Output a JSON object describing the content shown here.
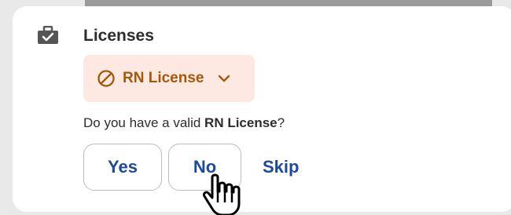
{
  "section": {
    "title": "Licenses",
    "icon": "briefcase-check-icon"
  },
  "license_chip": {
    "label": "RN License",
    "status_icon": "prohibited-icon",
    "dropdown_icon": "chevron-down-icon",
    "text_color": "#a3580a",
    "background_color": "#fde9e1"
  },
  "question": {
    "prefix": "Do you have a valid ",
    "highlight": "RN License",
    "suffix": "?"
  },
  "actions": {
    "yes_label": "Yes",
    "no_label": "No",
    "skip_label": "Skip",
    "accent_color": "#1d4a9a"
  },
  "cursor": {
    "icon": "hand-pointer-icon"
  }
}
